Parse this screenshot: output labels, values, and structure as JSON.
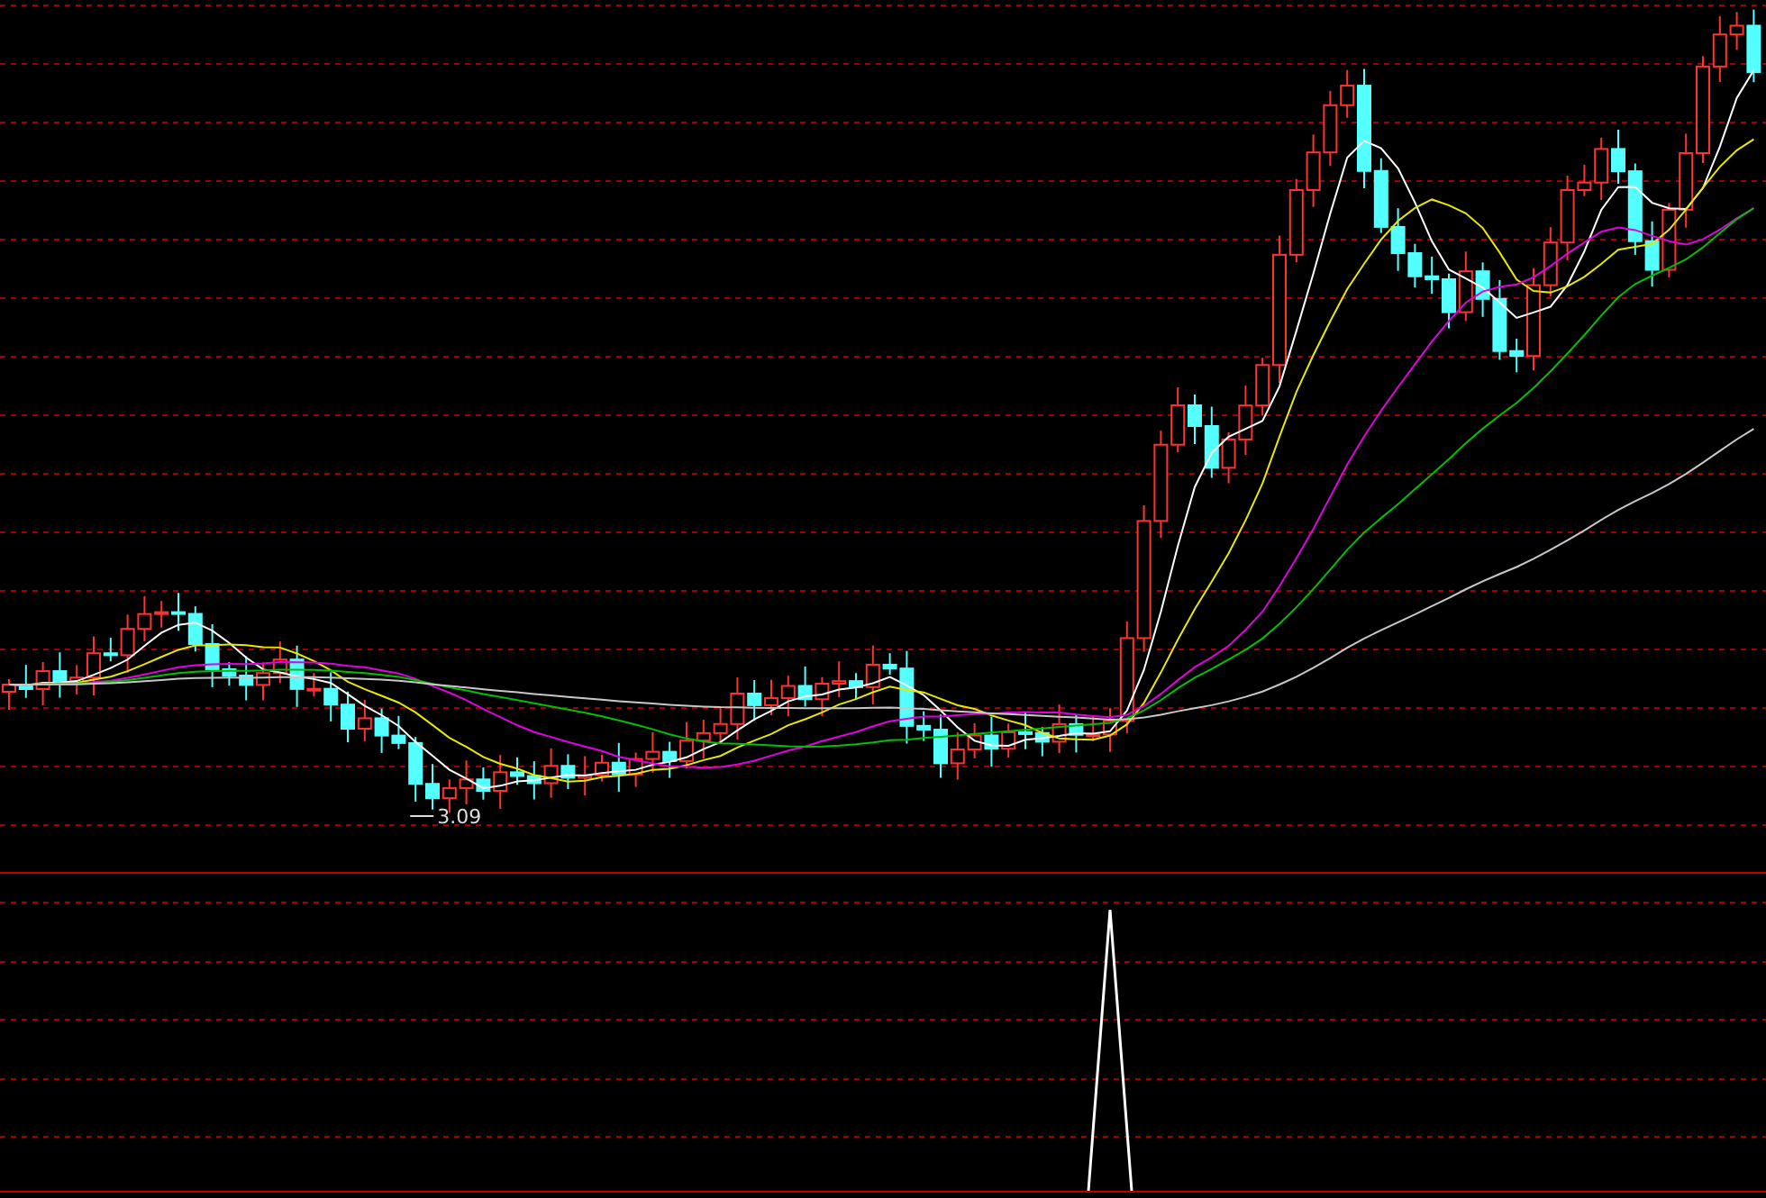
{
  "price_panel": {
    "low_marker": "3.09"
  }
}
